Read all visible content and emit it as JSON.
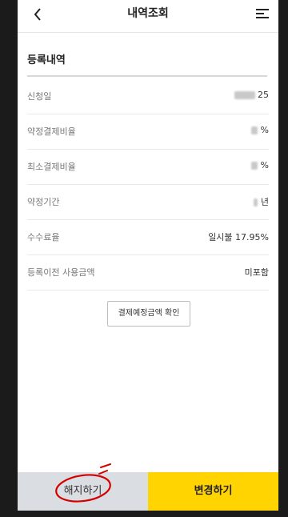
{
  "header": {
    "title": "내역조회"
  },
  "section": {
    "title": "등록내역"
  },
  "rows": [
    {
      "label": "신청일",
      "value": "25"
    },
    {
      "label": "약정결제비율",
      "value": "%"
    },
    {
      "label": "최소결제비율",
      "value": "%"
    },
    {
      "label": "약정기간",
      "value": "년"
    },
    {
      "label": "수수료율",
      "value": "일시불 17.95%"
    },
    {
      "label": "등록이전 사용금액",
      "value": "미포함"
    }
  ],
  "confirm_button": {
    "label": "결제예정금액 확인"
  },
  "bottom": {
    "cancel_label": "해지하기",
    "change_label": "변경하기"
  },
  "colors": {
    "accent": "#ffd400",
    "secondary_bg": "#dadde2",
    "annotation": "#d40000"
  }
}
